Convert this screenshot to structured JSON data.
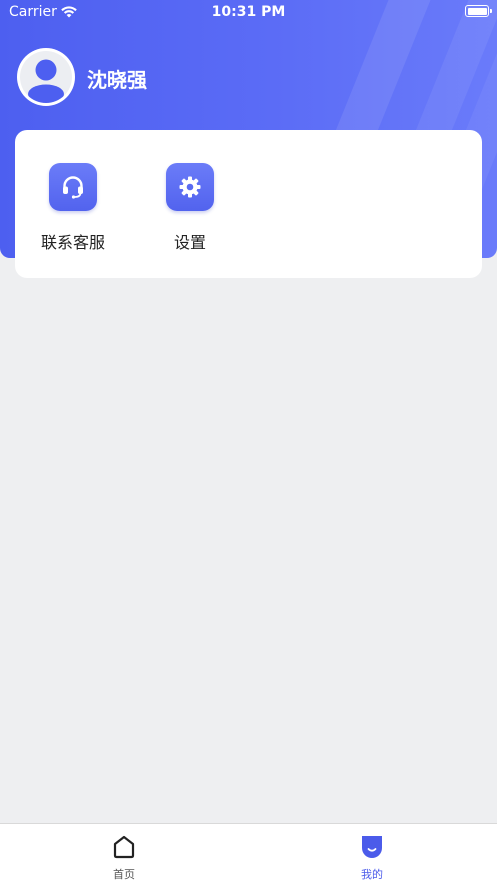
{
  "status_bar": {
    "carrier": "Carrier",
    "time": "10:31 PM",
    "wifi_icon": "wifi-icon",
    "battery_icon": "battery-icon"
  },
  "profile": {
    "avatar_icon": "user-avatar-icon",
    "username": "沈晓强"
  },
  "menu": {
    "items": [
      {
        "label": "联系客服",
        "icon": "headset-icon"
      },
      {
        "label": "设置",
        "icon": "gear-icon"
      }
    ]
  },
  "tab_bar": {
    "tabs": [
      {
        "label": "首页",
        "icon": "home-icon",
        "active": false
      },
      {
        "label": "我的",
        "icon": "profile-tab-icon",
        "active": true
      }
    ]
  },
  "colors": {
    "header_gradient_start": "#4d5ff0",
    "header_gradient_end": "#6a7bfa",
    "page_background": "#eeeff1",
    "accent": "#4b5bea",
    "inactive_tab": "#555555"
  }
}
